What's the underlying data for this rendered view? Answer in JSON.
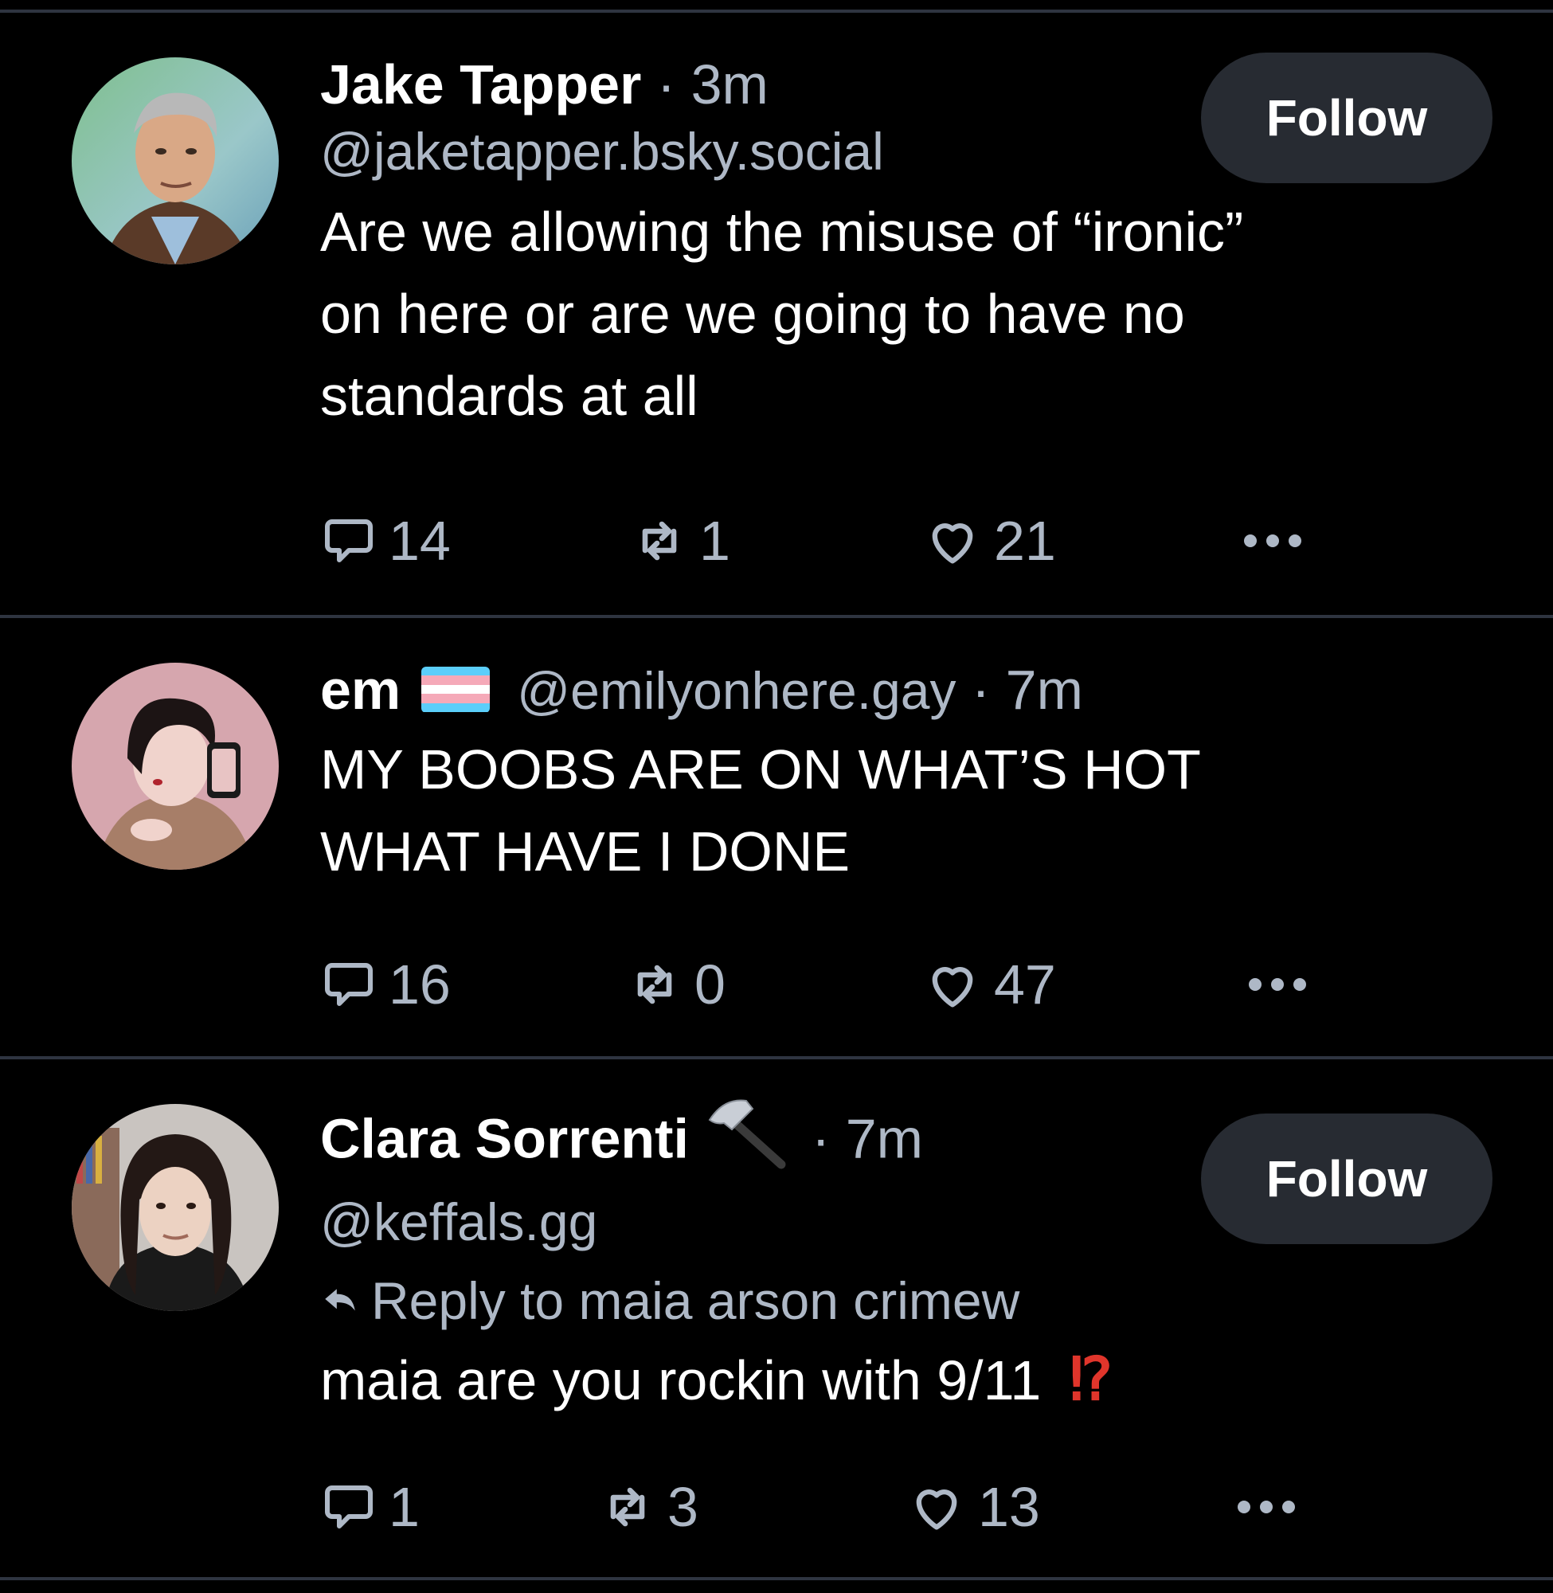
{
  "colors": {
    "background": "#000000",
    "divider": "#2e3440",
    "muted_text": "#aeb8c6",
    "follow_button_bg": "#272b32",
    "interrobang": "#e0352b"
  },
  "posts": [
    {
      "display_name": "Jake Tapper",
      "separator": "·",
      "time": "3m",
      "handle": "@jaketapper.bsky.social",
      "follow_label": "Follow",
      "text_lines": [
        "Are we allowing the misuse of “ironic”",
        "on here or are we going to have no",
        "standards at all"
      ],
      "replies": "14",
      "reposts": "1",
      "likes": "21"
    },
    {
      "display_name": "em",
      "badge": "transgender-flag-icon",
      "handle": "@emilyonhere.gay",
      "separator": "·",
      "time": "7m",
      "text_lines": [
        "MY BOOBS ARE ON WHAT’S HOT",
        "WHAT HAVE I DONE"
      ],
      "replies": "16",
      "reposts": "0",
      "likes": "47"
    },
    {
      "display_name": "Clara Sorrenti",
      "badge": "hammer-icon",
      "separator": "·",
      "time": "7m",
      "handle": "@keffals.gg",
      "follow_label": "Follow",
      "reply_to": "Reply to maia arson crimew",
      "text": "maia are you rockin with 9/11",
      "text_emoji": "⁉",
      "replies": "1",
      "reposts": "3",
      "likes": "13"
    }
  ]
}
